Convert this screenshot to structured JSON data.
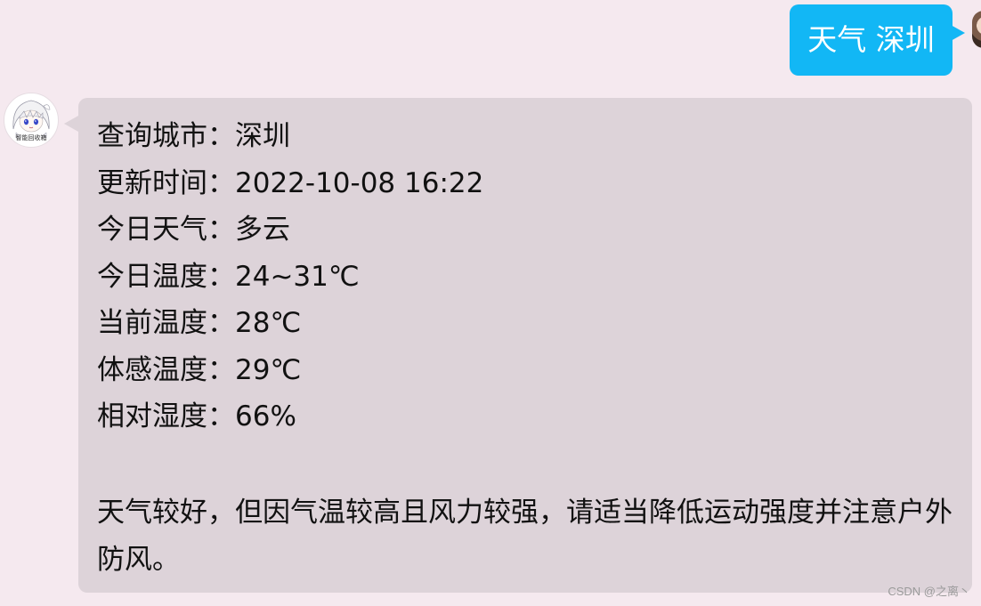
{
  "conversation": {
    "outgoing": {
      "text": "天气 深圳",
      "bubble_color": "#12b7f5",
      "avatar_icon": "user-avatar"
    },
    "incoming": {
      "bubble_color": "#ddd3d9",
      "avatar_icon": "bot-avatar-anime-girl",
      "avatar_caption": "智能回收箱",
      "lines": [
        "查询城市：深圳",
        "更新时间：2022-10-08 16:22",
        "今日天气：多云",
        "今日温度：24~31℃",
        "当前温度：28℃",
        "体感温度：29℃",
        "相对湿度：66%"
      ],
      "advice": "天气较好，但因气温较高且风力较强，请适当降低运动强度并注意户外防风。"
    }
  },
  "watermark": "CSDN @之离丶"
}
